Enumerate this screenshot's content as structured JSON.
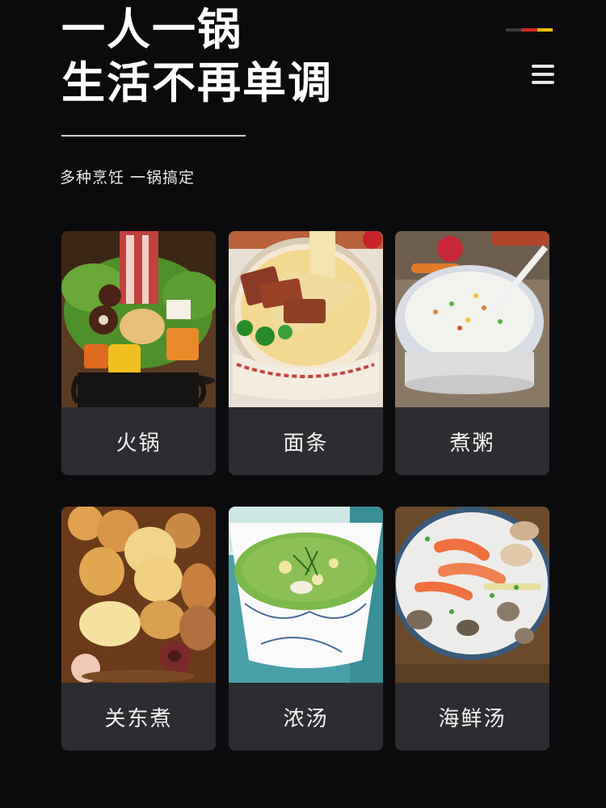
{
  "headline": {
    "line1": "一人一锅",
    "line2": "生活不再单调"
  },
  "subtitle": "多种烹饪 一锅搞定",
  "flag_colors": [
    "#3a3a3a",
    "#d42a22",
    "#f2c200"
  ],
  "menu_icon": "hamburger-menu-icon",
  "dishes": [
    {
      "label": "火锅"
    },
    {
      "label": "面条"
    },
    {
      "label": "煮粥"
    },
    {
      "label": "关东煮"
    },
    {
      "label": "浓汤"
    },
    {
      "label": "海鲜汤"
    }
  ]
}
